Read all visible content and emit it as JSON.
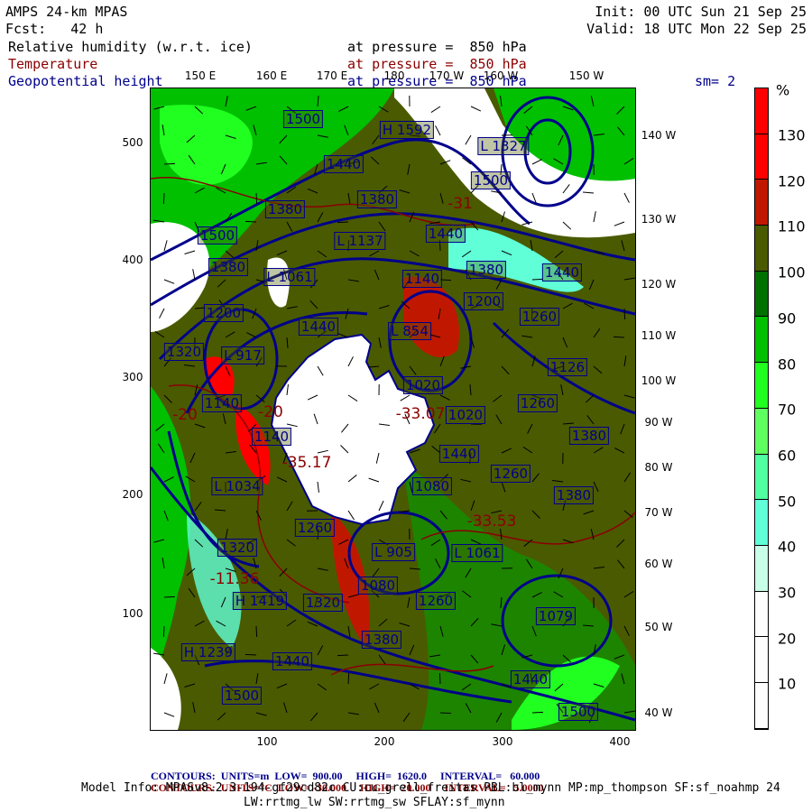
{
  "header": {
    "model": "AMPS 24-km MPAS",
    "fcst": "Fcst:   42 h",
    "init": "Init: 00 UTC Sun 21 Sep 25",
    "valid": "Valid: 18 UTC Mon 22 Sep 25",
    "fields": [
      {
        "name": "Relative humidity (w.r.t. ice)",
        "level": "at pressure =  850 hPa"
      },
      {
        "name": "Temperature",
        "level": "at pressure =  850 hPa"
      },
      {
        "name": "Geopotential height",
        "level": "at pressure =  850 hPa"
      }
    ],
    "smoothing": "sm= 2"
  },
  "axes": {
    "left": [
      "500",
      "400",
      "300",
      "200",
      "100"
    ],
    "bottom": [
      "100",
      "200",
      "300",
      "400"
    ],
    "top": [
      "150 E",
      "160 E",
      "170 E",
      "180",
      "170 W",
      "160 W",
      "150 W"
    ],
    "right": [
      "140 W",
      "130 W",
      "120 W",
      "110 W",
      "100 W",
      "90 W",
      "80 W",
      "70 W",
      "60 W",
      "50 W",
      "40 W"
    ]
  },
  "colorbar": {
    "unit": "%",
    "labels": [
      "130",
      "120",
      "110",
      "100",
      "90",
      "80",
      "70",
      "60",
      "50",
      "40",
      "30",
      "20",
      "10"
    ],
    "colors": [
      "#ff0000",
      "#ff0000",
      "#c01800",
      "#4a5a00",
      "#007000",
      "#00c000",
      "#20ff20",
      "#60ff60",
      "#50ffa0",
      "#60ffd8",
      "#c8ffe8",
      "#ffffff",
      "#ffffff",
      "#ffffff"
    ]
  },
  "height_labels": [
    "1500",
    "H 1592",
    "L 1327",
    "1500",
    "1440",
    "1380",
    "1380",
    "1500",
    "L 1137",
    "1440",
    "1380",
    "L 1061",
    "1140",
    "1380",
    "1440",
    "1200",
    "1200",
    "1260",
    "1440",
    "L 854",
    "1320",
    "L 917",
    "1126",
    "1020",
    "1140",
    "1260",
    "1140",
    "1020",
    "1380",
    "1440",
    "1260",
    "1080",
    "1380",
    "L 1034",
    "1260",
    "1320",
    "L 905",
    "L 1061",
    "H 1419",
    "1320",
    "1080",
    "1260",
    "1079",
    "1380",
    "H 1239",
    "1440",
    "1440",
    "1500",
    "1500"
  ],
  "temp_labels": [
    "-33.07",
    "-35.17",
    "-20",
    "-31",
    "-33.53",
    "-11.36",
    "-20"
  ],
  "footer": {
    "blue": {
      "c": "CONTOURS:",
      "u": "UNITS=m",
      "low": "LOW=  900.00",
      "high": "HIGH=  1620.0",
      "int": "INTERVAL=   60.000"
    },
    "red": {
      "c": "CONTOURS:",
      "u": "UNITS=°C",
      "low": "LOW= -30.000",
      "high": "HIGH=  20.000",
      "int": "INTERVAL=   5.0000"
    },
    "model_info": "Model Info: MPASv8.2.3-194-gf29cd82c CU:cu_grell_freitas PBL:bl_mynn MP:mp_thompson SF:sf_noahmp 24",
    "model_info2": "LW:rrtmg_lw SW:rrtmg_sw SFLAY:sf_mynn"
  }
}
